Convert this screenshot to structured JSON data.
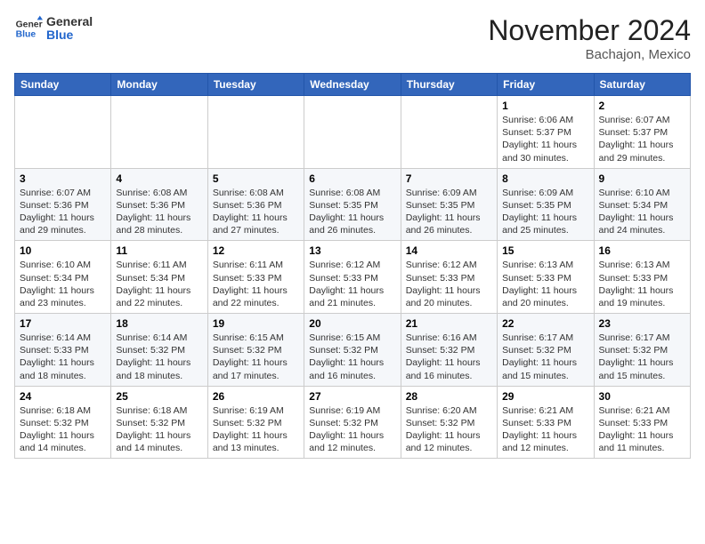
{
  "header": {
    "logo_general": "General",
    "logo_blue": "Blue",
    "month_title": "November 2024",
    "location": "Bachajon, Mexico"
  },
  "days_of_week": [
    "Sunday",
    "Monday",
    "Tuesday",
    "Wednesday",
    "Thursday",
    "Friday",
    "Saturday"
  ],
  "weeks": [
    [
      {
        "day": "",
        "info": ""
      },
      {
        "day": "",
        "info": ""
      },
      {
        "day": "",
        "info": ""
      },
      {
        "day": "",
        "info": ""
      },
      {
        "day": "",
        "info": ""
      },
      {
        "day": "1",
        "info": "Sunrise: 6:06 AM\nSunset: 5:37 PM\nDaylight: 11 hours and 30 minutes."
      },
      {
        "day": "2",
        "info": "Sunrise: 6:07 AM\nSunset: 5:37 PM\nDaylight: 11 hours and 29 minutes."
      }
    ],
    [
      {
        "day": "3",
        "info": "Sunrise: 6:07 AM\nSunset: 5:36 PM\nDaylight: 11 hours and 29 minutes."
      },
      {
        "day": "4",
        "info": "Sunrise: 6:08 AM\nSunset: 5:36 PM\nDaylight: 11 hours and 28 minutes."
      },
      {
        "day": "5",
        "info": "Sunrise: 6:08 AM\nSunset: 5:36 PM\nDaylight: 11 hours and 27 minutes."
      },
      {
        "day": "6",
        "info": "Sunrise: 6:08 AM\nSunset: 5:35 PM\nDaylight: 11 hours and 26 minutes."
      },
      {
        "day": "7",
        "info": "Sunrise: 6:09 AM\nSunset: 5:35 PM\nDaylight: 11 hours and 26 minutes."
      },
      {
        "day": "8",
        "info": "Sunrise: 6:09 AM\nSunset: 5:35 PM\nDaylight: 11 hours and 25 minutes."
      },
      {
        "day": "9",
        "info": "Sunrise: 6:10 AM\nSunset: 5:34 PM\nDaylight: 11 hours and 24 minutes."
      }
    ],
    [
      {
        "day": "10",
        "info": "Sunrise: 6:10 AM\nSunset: 5:34 PM\nDaylight: 11 hours and 23 minutes."
      },
      {
        "day": "11",
        "info": "Sunrise: 6:11 AM\nSunset: 5:34 PM\nDaylight: 11 hours and 22 minutes."
      },
      {
        "day": "12",
        "info": "Sunrise: 6:11 AM\nSunset: 5:33 PM\nDaylight: 11 hours and 22 minutes."
      },
      {
        "day": "13",
        "info": "Sunrise: 6:12 AM\nSunset: 5:33 PM\nDaylight: 11 hours and 21 minutes."
      },
      {
        "day": "14",
        "info": "Sunrise: 6:12 AM\nSunset: 5:33 PM\nDaylight: 11 hours and 20 minutes."
      },
      {
        "day": "15",
        "info": "Sunrise: 6:13 AM\nSunset: 5:33 PM\nDaylight: 11 hours and 20 minutes."
      },
      {
        "day": "16",
        "info": "Sunrise: 6:13 AM\nSunset: 5:33 PM\nDaylight: 11 hours and 19 minutes."
      }
    ],
    [
      {
        "day": "17",
        "info": "Sunrise: 6:14 AM\nSunset: 5:33 PM\nDaylight: 11 hours and 18 minutes."
      },
      {
        "day": "18",
        "info": "Sunrise: 6:14 AM\nSunset: 5:32 PM\nDaylight: 11 hours and 18 minutes."
      },
      {
        "day": "19",
        "info": "Sunrise: 6:15 AM\nSunset: 5:32 PM\nDaylight: 11 hours and 17 minutes."
      },
      {
        "day": "20",
        "info": "Sunrise: 6:15 AM\nSunset: 5:32 PM\nDaylight: 11 hours and 16 minutes."
      },
      {
        "day": "21",
        "info": "Sunrise: 6:16 AM\nSunset: 5:32 PM\nDaylight: 11 hours and 16 minutes."
      },
      {
        "day": "22",
        "info": "Sunrise: 6:17 AM\nSunset: 5:32 PM\nDaylight: 11 hours and 15 minutes."
      },
      {
        "day": "23",
        "info": "Sunrise: 6:17 AM\nSunset: 5:32 PM\nDaylight: 11 hours and 15 minutes."
      }
    ],
    [
      {
        "day": "24",
        "info": "Sunrise: 6:18 AM\nSunset: 5:32 PM\nDaylight: 11 hours and 14 minutes."
      },
      {
        "day": "25",
        "info": "Sunrise: 6:18 AM\nSunset: 5:32 PM\nDaylight: 11 hours and 14 minutes."
      },
      {
        "day": "26",
        "info": "Sunrise: 6:19 AM\nSunset: 5:32 PM\nDaylight: 11 hours and 13 minutes."
      },
      {
        "day": "27",
        "info": "Sunrise: 6:19 AM\nSunset: 5:32 PM\nDaylight: 11 hours and 12 minutes."
      },
      {
        "day": "28",
        "info": "Sunrise: 6:20 AM\nSunset: 5:32 PM\nDaylight: 11 hours and 12 minutes."
      },
      {
        "day": "29",
        "info": "Sunrise: 6:21 AM\nSunset: 5:33 PM\nDaylight: 11 hours and 12 minutes."
      },
      {
        "day": "30",
        "info": "Sunrise: 6:21 AM\nSunset: 5:33 PM\nDaylight: 11 hours and 11 minutes."
      }
    ]
  ]
}
